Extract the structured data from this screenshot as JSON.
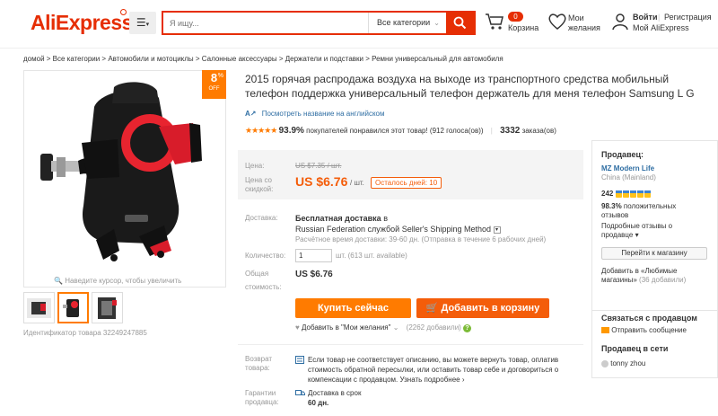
{
  "header": {
    "logo": "AliExpress",
    "search_placeholder": "Я ищу...",
    "search_category": "Все категории",
    "cart_count": "0",
    "cart_label": "Корзина",
    "wishlist_label_1": "Мои",
    "wishlist_label_2": "желания",
    "signin": "Войти",
    "register": "Регистрация",
    "my_account": "Мой AliExpress"
  },
  "breadcrumb": "домой > Все категории > Автомобили и мотоциклы > Салонные аксессуары > Держатели и подставки > Ремни универсальный для автомобиля",
  "gallery": {
    "discount_num": "8",
    "discount_pct": "%",
    "discount_off": "OFF",
    "zoom_hint": "Наведите курсор, чтобы увеличить",
    "product_id": "Идентификатор товара 32249247885"
  },
  "product": {
    "title": "2015 горячая распродажа воздуха на выходе из транспортного средства мобильный телефон поддержка универсальный телефон держатель для меня телефон Samsung L G",
    "translate_link": "Посмотреть название на английском",
    "stars": "★★★★★",
    "positive_pct": "93.9%",
    "positive_text": "покупателей понравился этот товар! (912 голоса(ов))",
    "orders_num": "3332",
    "orders_label": "заказа(ов)"
  },
  "price": {
    "old_label": "Цена:",
    "old_value": "US $7.35 / шт.",
    "new_label_1": "Цена со",
    "new_label_2": "скидкой:",
    "new_value": "US $6.76",
    "per_unit": "/ шт.",
    "days_left": "Осталось дней: 10"
  },
  "shipping": {
    "label": "Доставка:",
    "free": "Бесплатная доставка",
    "to": "в",
    "method": "Russian Federation службой Seller's Shipping Method",
    "time": "Расчётное время доставки: 39-60 дн. (Отправка в течение 6 рабочих дней)"
  },
  "quantity": {
    "label": "Количество:",
    "value": "1",
    "unit": "шт. (613 шт. available)"
  },
  "total": {
    "label_1": "Общая",
    "label_2": "стоимость:",
    "value": "US $6.76"
  },
  "actions": {
    "buy_now": "Купить сейчас",
    "add_to_cart": "Добавить в корзину",
    "wishlist": "Добавить в \"Мои желания\"",
    "wishlist_count": "(2262 добавили)"
  },
  "returns": {
    "label_1": "Возврат",
    "label_2": "товара:",
    "text": "Если товар не соответствует описанию, вы можете вернуть товар, оплатив стоимость обратной пересылки, или оставить товар себе и договориться о компенсации с продавцом.",
    "more": "Узнать подробнее"
  },
  "guarantee": {
    "label_1": "Гарантии",
    "label_2": "продавца:",
    "text": "Доставка в срок",
    "days": "60 дн."
  },
  "seller": {
    "heading": "Продавец:",
    "name": "MZ Modern Life",
    "country": "China (Mainland)",
    "score": "242",
    "feedback_pct": "98.3%",
    "feedback_text_1": "положительных",
    "feedback_text_2": "отзывов",
    "details_1": "Подробные отзывы о",
    "details_2": "продавце",
    "goto_shop": "Перейти к магазину",
    "fav_1": "Добавить в «Любимые",
    "fav_2": "магазины»",
    "fav_count": "(36 добавили)"
  },
  "contact": {
    "heading": "Связаться с продавцом",
    "message": "Отправить сообщение",
    "online_heading": "Продавец в сети",
    "online_name": "tonny zhou"
  },
  "colors": {
    "brand": "#e62e04",
    "orange": "#ff7b00",
    "price": "#f45d0a",
    "link": "#2f6ea3"
  }
}
